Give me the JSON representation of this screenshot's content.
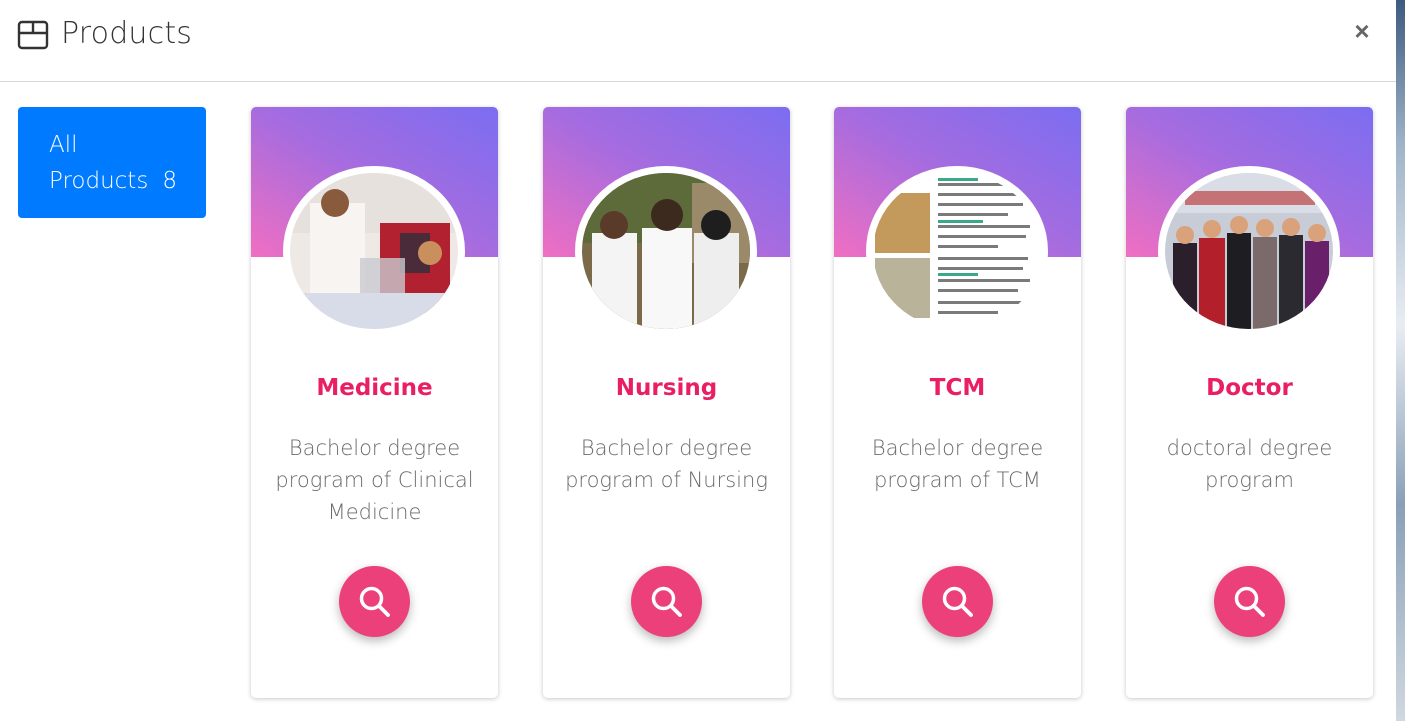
{
  "header": {
    "title": "Products",
    "icon": "box-icon",
    "close_label": "×"
  },
  "sidebar": {
    "all_products_label": "All Products",
    "all_products_count": "8"
  },
  "colors": {
    "accent": "#007bff",
    "title_pink": "#e91e63",
    "button_pink": "#ec407a",
    "gradient_start": "#f06fc2",
    "gradient_end": "#7b6df1"
  },
  "products": [
    {
      "title": "Medicine",
      "description": "Bachelor degree program of Clinical Medicine",
      "image": "students-lab-photo",
      "action_icon": "search-icon"
    },
    {
      "title": "Nursing",
      "description": "Bachelor degree program of Nursing",
      "image": "nurses-photo",
      "action_icon": "search-icon"
    },
    {
      "title": "TCM",
      "description": "Bachelor degree program of TCM",
      "image": "brochure-photo",
      "action_icon": "search-icon"
    },
    {
      "title": "Doctor",
      "description": "doctoral degree program",
      "image": "graduation-photo",
      "action_icon": "search-icon"
    }
  ]
}
